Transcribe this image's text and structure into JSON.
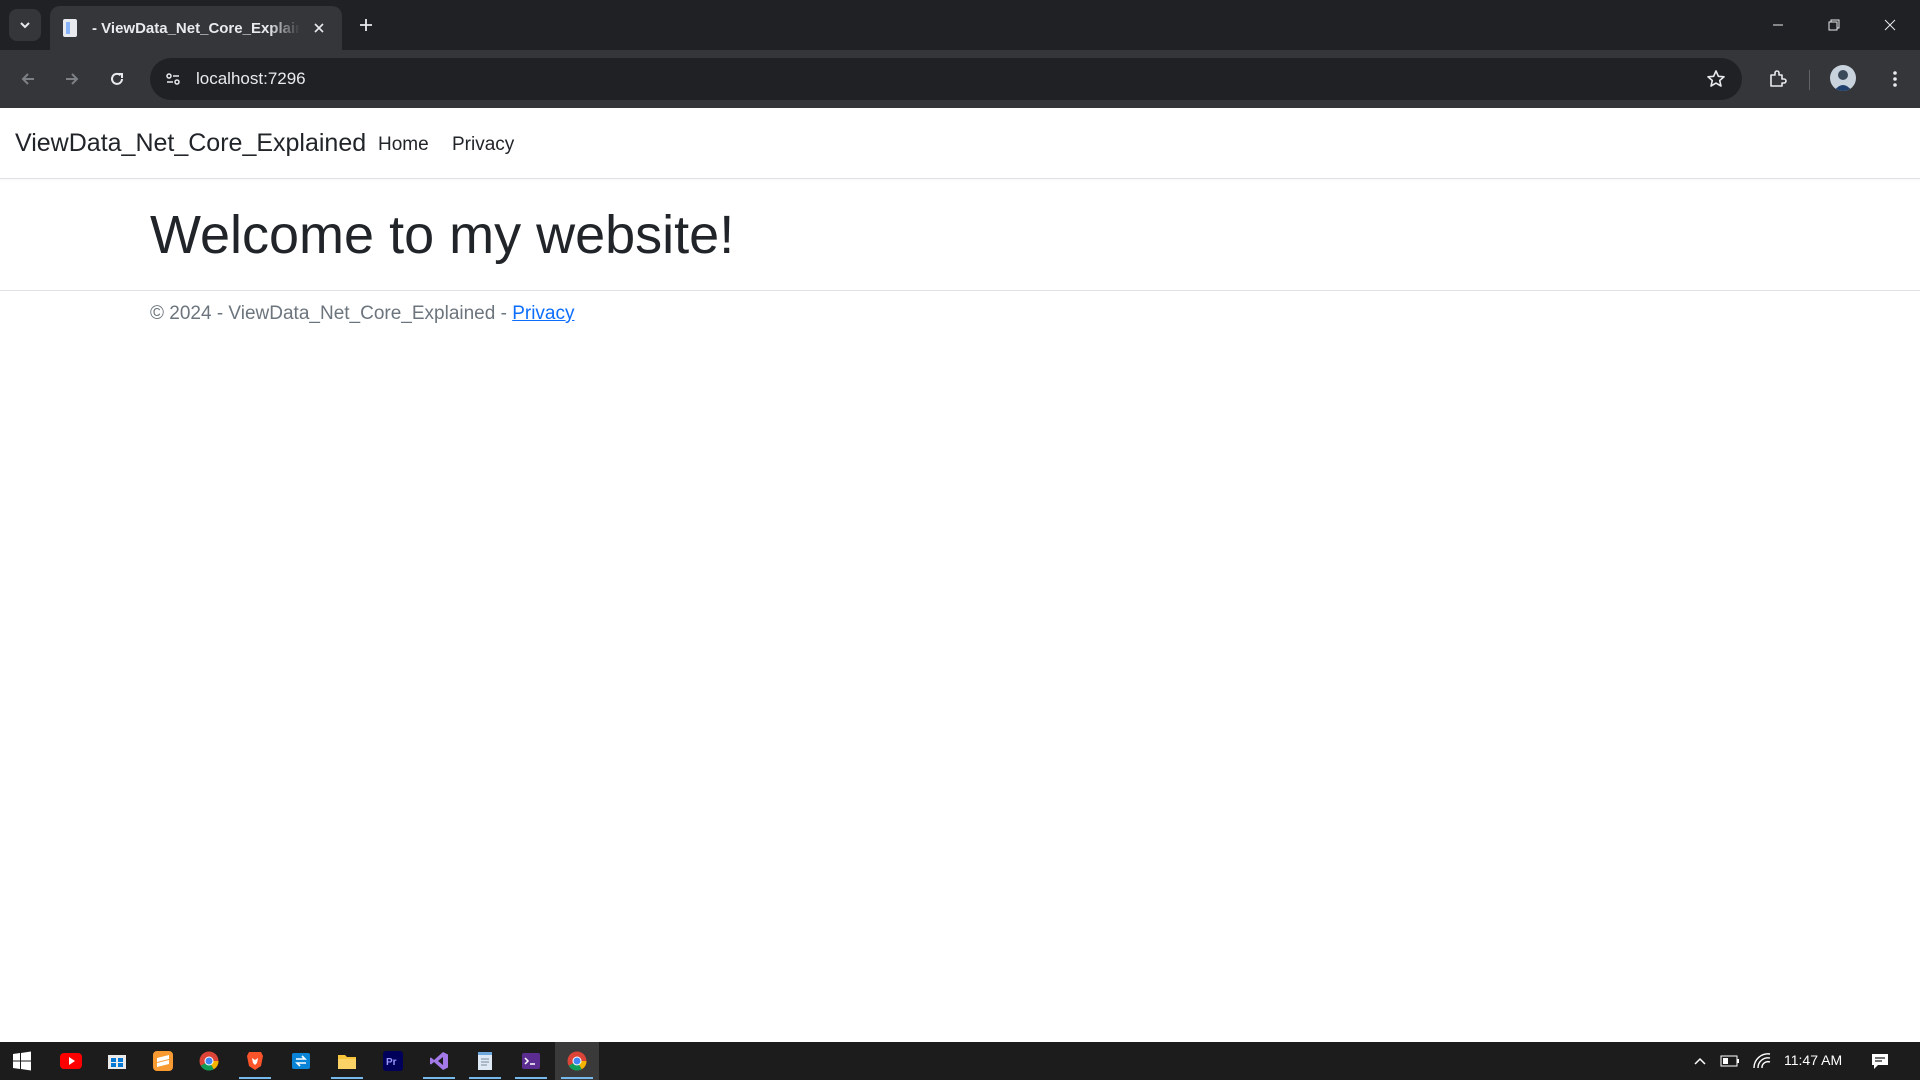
{
  "browser": {
    "tab_title": "- ViewData_Net_Core_Explained",
    "url": "localhost:7296",
    "colors": {
      "frame": "#202124",
      "toolbar": "#35363a",
      "text": "#e8eaed"
    }
  },
  "site": {
    "brand": "ViewData_Net_Core_Explained",
    "nav": [
      {
        "label": "Home"
      },
      {
        "label": "Privacy"
      }
    ],
    "heading": "Welcome to my website!",
    "footer": {
      "copyright": "© 2024 - ViewData_Net_Core_Explained - ",
      "link": "Privacy"
    },
    "colors": {
      "text": "#212529",
      "muted": "#6c757d",
      "link": "#0d6efd",
      "border": "#dee2e6"
    }
  },
  "taskbar": {
    "apps": [
      {
        "name": "youtube-icon"
      },
      {
        "name": "store-icon"
      },
      {
        "name": "sublime-icon"
      },
      {
        "name": "chrome-icon"
      },
      {
        "name": "brave-icon"
      },
      {
        "name": "remote-icon"
      },
      {
        "name": "file-explorer-icon"
      },
      {
        "name": "premiere-icon"
      },
      {
        "name": "visual-studio-icon"
      },
      {
        "name": "notepad-icon"
      },
      {
        "name": "terminal-icon"
      },
      {
        "name": "chrome-active-icon"
      }
    ],
    "clock": "11:47 AM"
  }
}
